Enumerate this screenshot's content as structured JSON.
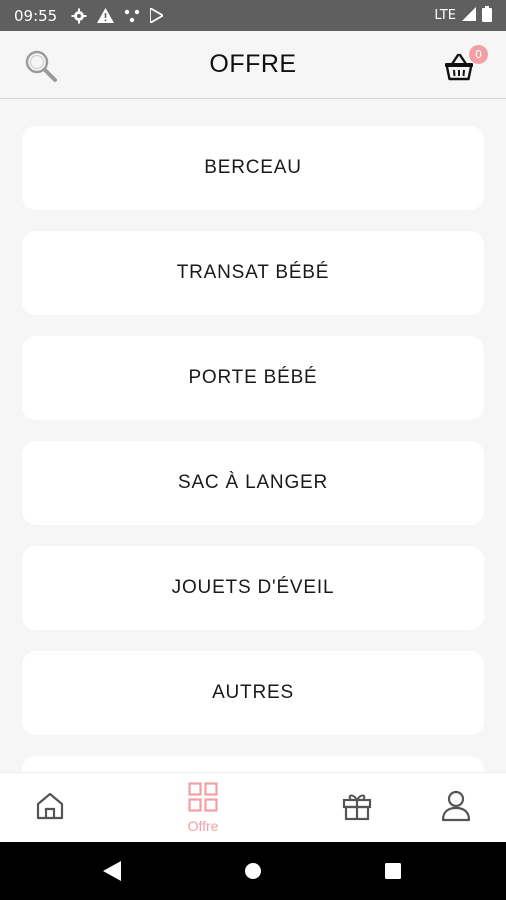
{
  "status_bar": {
    "time": "09:55",
    "network": "LTE",
    "icons": [
      "gear-icon",
      "warning-icon",
      "share-icon",
      "play-store-icon",
      "signal-icon",
      "battery-icon"
    ]
  },
  "header": {
    "title": "OFFRE",
    "cart_count": "0"
  },
  "categories": [
    {
      "label": "BERCEAU"
    },
    {
      "label": "TRANSAT BÉBÉ"
    },
    {
      "label": "PORTE BÉBÉ"
    },
    {
      "label": "SAC À LANGER"
    },
    {
      "label": "JOUETS D'ÉVEIL"
    },
    {
      "label": "AUTRES"
    }
  ],
  "bottom_nav": {
    "items": [
      {
        "icon": "home-icon",
        "label": ""
      },
      {
        "icon": "grid-icon",
        "label": "Offre",
        "active": true
      },
      {
        "icon": "gift-icon",
        "label": ""
      },
      {
        "icon": "user-icon",
        "label": ""
      }
    ],
    "active_color": "#f3a0a4",
    "inactive_color": "#555555"
  },
  "android_nav": [
    "back-icon",
    "home-circle-icon",
    "recents-icon"
  ]
}
